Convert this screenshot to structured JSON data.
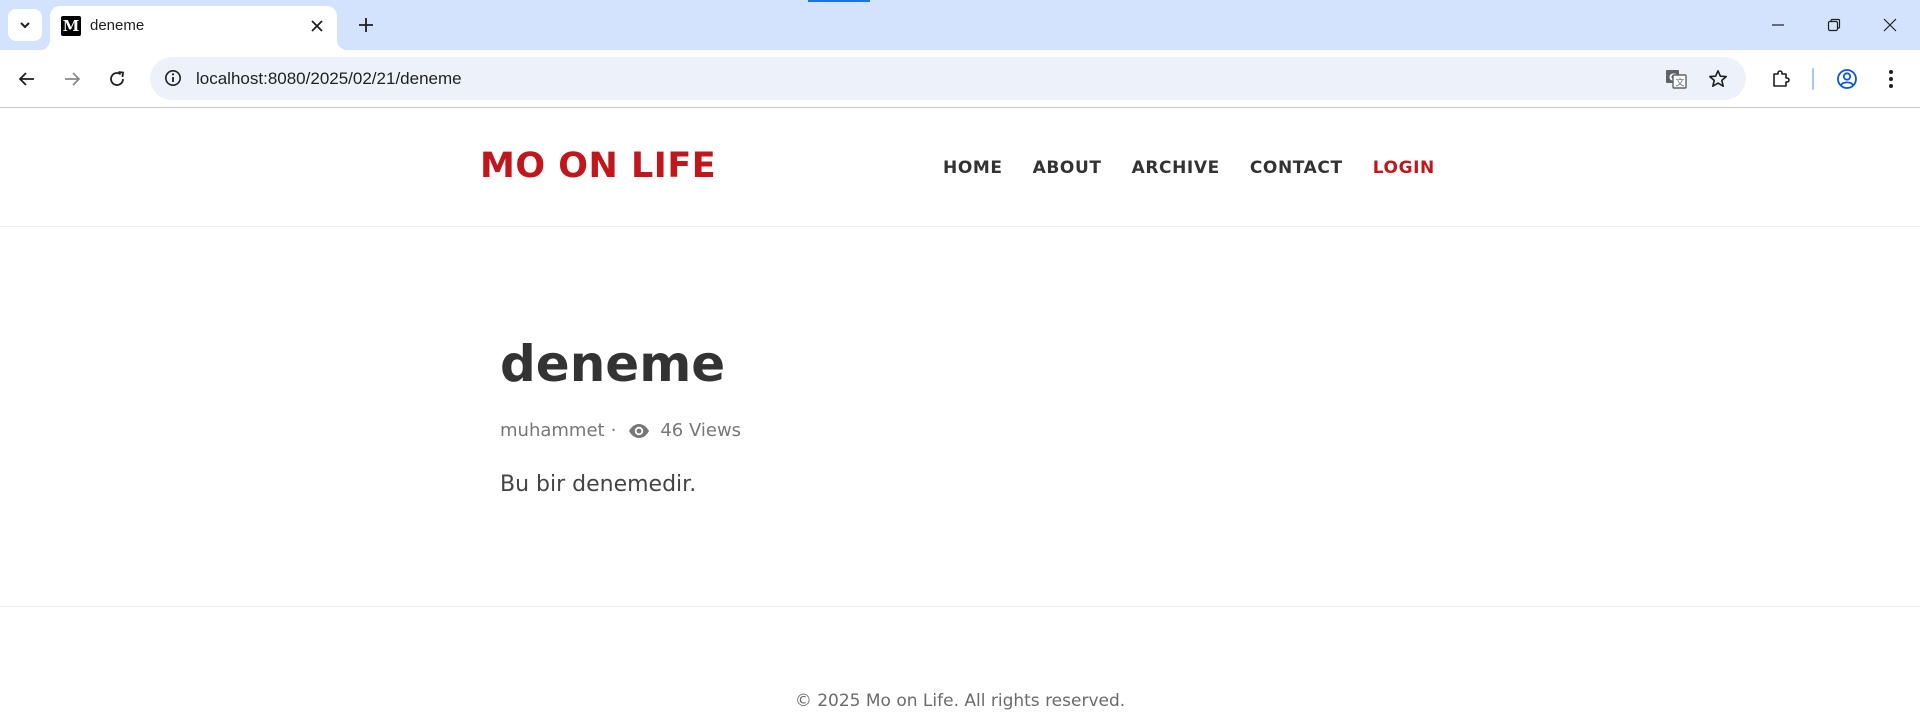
{
  "browser": {
    "tab_title": "deneme",
    "favicon_letter": "M",
    "url": "localhost:8080/2025/02/21/deneme"
  },
  "site": {
    "brand": "MO ON LIFE",
    "nav": {
      "home": "HOME",
      "about": "ABOUT",
      "archive": "ARCHIVE",
      "contact": "CONTACT",
      "login": "LOGIN"
    },
    "accent_color": "#c0171c"
  },
  "post": {
    "title": "deneme",
    "author": "muhammet",
    "separator": "·",
    "views": "46 Views",
    "body": "Bu bir denemedir."
  },
  "footer": {
    "copyright": "© 2025 Mo on Life. All rights reserved."
  }
}
